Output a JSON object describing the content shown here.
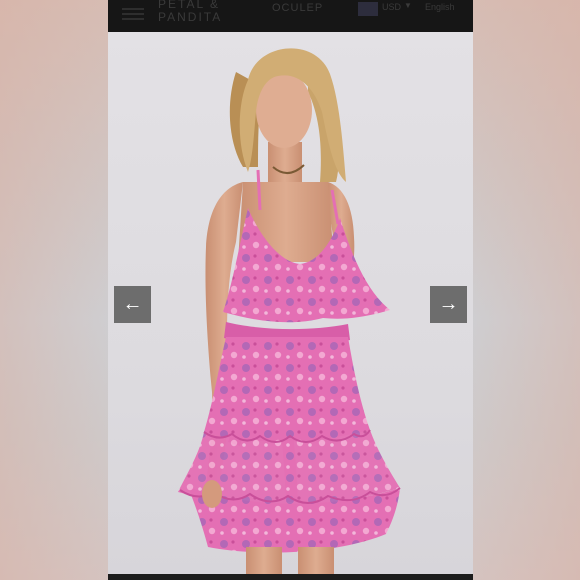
{
  "header": {
    "brand_line1": "PETAL &",
    "brand_line2": "PANDITA",
    "nav_label": "OCULEP",
    "currency": "USD",
    "language": "English",
    "icons": [
      "menu-icon",
      "flag-icon",
      "chevron-down-icon"
    ]
  },
  "gallery": {
    "prev_icon": "←",
    "next_icon": "→",
    "image": "product-photo-pink-floral-ruffle-mini-dress"
  },
  "colors": {
    "dress_pink": "#e46fb4",
    "dress_deep": "#c94f9a",
    "floral_purple": "#8b63b8",
    "skin": "#d8a488",
    "hair": "#c9a46a",
    "background": "#e2e0e2",
    "topbar": "#161616",
    "arrow_button": "#6d6d6d"
  }
}
